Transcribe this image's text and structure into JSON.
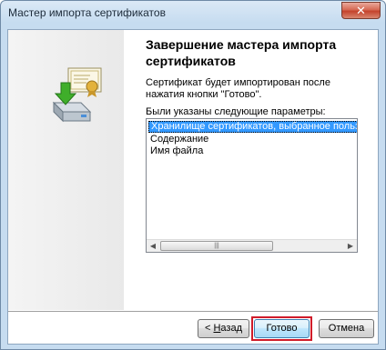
{
  "window": {
    "title": "Мастер импорта сертификатов",
    "close_symbol": "✕"
  },
  "page": {
    "heading": "Завершение мастера импорта сертификатов",
    "description": "Сертификат будет импортирован после нажатия кнопки \"Готово\".",
    "params_label": "Были указаны следующие параметры:",
    "params": [
      "Хранилище сертификатов, выбранное пользователем",
      "Содержание",
      "Имя файла"
    ],
    "selected_index": 0
  },
  "buttons": {
    "back_prefix": "< ",
    "back_key": "Н",
    "back_rest": "азад",
    "finish": "Готово",
    "cancel": "Отмена"
  },
  "icons": {
    "close": "close-icon",
    "wizard": "certificate-import-icon",
    "scroll_left": "arrow-left-icon",
    "scroll_right": "arrow-right-icon"
  },
  "colors": {
    "accent_selection": "#3399ff",
    "focus_highlight": "#d01c2a"
  }
}
